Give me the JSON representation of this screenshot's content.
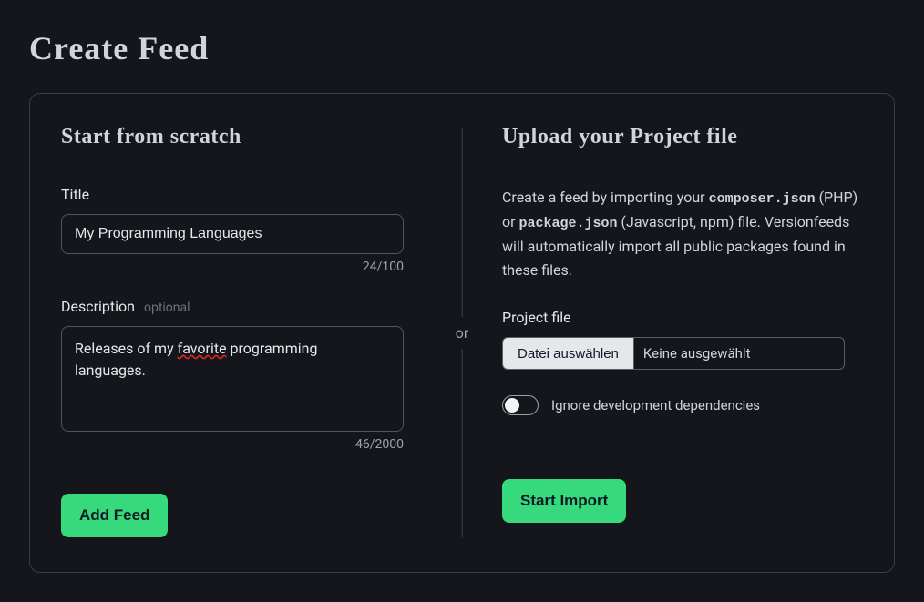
{
  "page": {
    "title": "Create Feed"
  },
  "divider": {
    "or": "or"
  },
  "scratch": {
    "heading": "Start from scratch",
    "title_label": "Title",
    "title_value": "My Programming Languages",
    "title_counter": "24/100",
    "description_label": "Description",
    "optional": "optional",
    "description_value_pre": "Releases of my ",
    "description_value_err": "favorite",
    "description_value_post": " programming languages.",
    "description_counter": "46/2000",
    "submit": "Add Feed"
  },
  "upload": {
    "heading": "Upload your Project file",
    "intro_1": "Create a feed by importing your ",
    "code_1": "composer.json",
    "intro_2": " (PHP) or ",
    "code_2": "package.json",
    "intro_3": " (Javascript, npm) file. Versionfeeds will automatically import all public packages found in these files.",
    "file_label": "Project file",
    "file_button": "Datei auswählen",
    "file_status": "Keine ausgewählt",
    "toggle_label": "Ignore development dependencies",
    "submit": "Start Import"
  }
}
